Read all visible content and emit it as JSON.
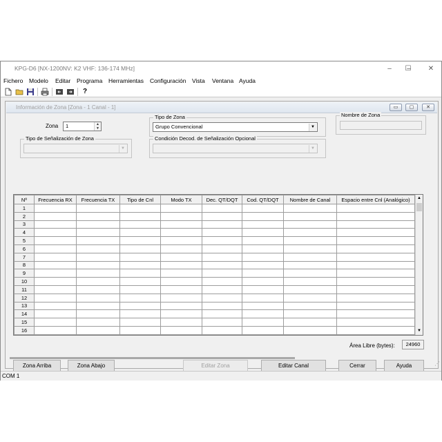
{
  "window": {
    "title": "KPG-D6 [NX-1200NV: K2 VHF: 136-174 MHz]",
    "controls": [
      "–",
      "☐",
      "✕"
    ]
  },
  "menu": [
    "Fichero",
    "Modelo",
    "Editar",
    "Programa",
    "Herramientas",
    "Configuración",
    "Vista",
    "Ventana",
    "Ayuda"
  ],
  "toolbar": {
    "icons": [
      "new-file-icon",
      "open-folder-icon",
      "save-icon",
      "print-icon",
      "read-radio-icon",
      "write-radio-icon",
      "help-icon"
    ],
    "glyphs": [
      "🗋",
      "📂",
      "💾",
      "🖶",
      "⇦",
      "⇨",
      "?"
    ]
  },
  "child": {
    "title": "Información de Zona [Zona - 1   Canal - 1]",
    "controls": [
      "▭",
      "▢",
      "✕"
    ]
  },
  "zone": {
    "label": "Zona",
    "value": "1"
  },
  "zone_type": {
    "label": "Tipo de Zona",
    "value": "Grupo Convencional"
  },
  "zone_name": {
    "label": "Nombre de Zona",
    "value": ""
  },
  "signaling": {
    "label": "Tipo de Señalización de Zona",
    "value": ""
  },
  "optional_decode": {
    "label": "Condición Decod. de Señalización Opcional",
    "value": ""
  },
  "grid": {
    "columns": [
      "Nº",
      "Frecuencia RX",
      "Frecuencia TX",
      "Tipo de Cnl",
      "Modo TX",
      "Dec. QT/DQT",
      "Cod. QT/DQT",
      "Nombre de Canal",
      "Espacio entre Cnl (Analógico)"
    ],
    "rows": [
      "1",
      "2",
      "3",
      "4",
      "5",
      "6",
      "7",
      "8",
      "9",
      "10",
      "11",
      "12",
      "13",
      "14",
      "15",
      "16"
    ]
  },
  "free_area": {
    "label": "Área Libre (bytes):",
    "value": "24960"
  },
  "buttons": {
    "zone_up": "Zona Arriba",
    "zone_down": "Zona Abajo",
    "edit_zone": "Editar Zona",
    "edit_channel": "Editar Canal",
    "close": "Cerrar",
    "help": "Ayuda"
  },
  "status": {
    "port": "COM 1"
  }
}
